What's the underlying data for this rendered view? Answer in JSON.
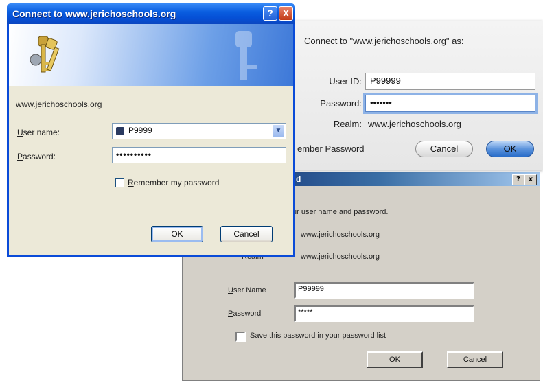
{
  "win98": {
    "title": "Enter Network Password",
    "title_visible": "d",
    "help_label": "?",
    "close_label": "x",
    "prompt": "Please type your user name and password.",
    "prompt_visible": "ur user name and password.",
    "site_value": "www.jerichoschools.org",
    "realm_label": "Realm",
    "realm_value": "www.jerichoschools.org",
    "username_label": "User Name",
    "username_value": "P99999",
    "password_label": "Password",
    "password_value": "*****",
    "save_password_label": "Save this password in your password list",
    "ok_label": "OK",
    "cancel_label": "Cancel"
  },
  "mac": {
    "heading": "Connect to \"www.jerichoschools.org\" as:",
    "userid_label": "User ID:",
    "userid_value": "P99999",
    "password_label": "Password:",
    "password_value": "•••••••",
    "realm_label": "Realm:",
    "realm_value": "www.jerichoschools.org",
    "remember_label": "Remember Password",
    "remember_visible": "ember Password",
    "cancel_label": "Cancel",
    "ok_label": "OK",
    "accent_color": "#2a6dc9"
  },
  "xp": {
    "title": "Connect to www.jerichoschools.org",
    "help_label": "?",
    "close_label": "X",
    "site": "www.jerichoschools.org",
    "username_label": "User name:",
    "username_value": "P9999",
    "password_label": "Password:",
    "password_value": "••••••••••",
    "remember_label": "Remember my password",
    "ok_label": "OK",
    "cancel_label": "Cancel",
    "accent_color": "#0a5ee0",
    "icon": "keys-icon"
  }
}
